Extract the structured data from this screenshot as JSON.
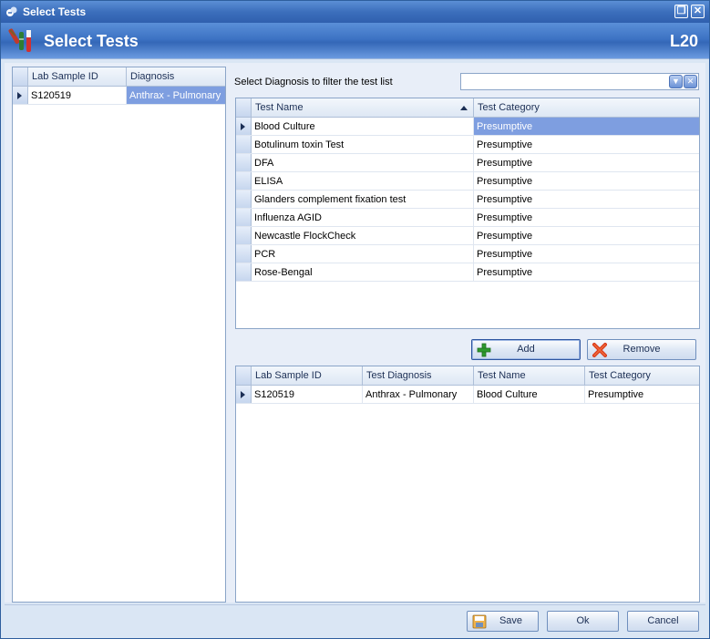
{
  "window": {
    "title": "Select Tests",
    "header_title": "Select Tests",
    "header_code": "L20",
    "restore_glyph": "❐",
    "close_glyph": "✕"
  },
  "samples_grid": {
    "columns": [
      "Lab Sample ID",
      "Diagnosis"
    ],
    "rows": [
      {
        "lab_sample_id": "S120519",
        "diagnosis": "Anthrax - Pulmonary"
      }
    ]
  },
  "filter": {
    "label": "Select Diagnosis to filter the test list",
    "value": ""
  },
  "tests_grid": {
    "columns": [
      "Test Name",
      "Test Category"
    ],
    "sort": "Test Name ascending",
    "rows": [
      {
        "test_name": "Blood Culture",
        "test_category": "Presumptive"
      },
      {
        "test_name": "Botulinum toxin Test",
        "test_category": "Presumptive"
      },
      {
        "test_name": "DFA",
        "test_category": "Presumptive"
      },
      {
        "test_name": "ELISA",
        "test_category": "Presumptive"
      },
      {
        "test_name": "Glanders complement fixation test",
        "test_category": "Presumptive"
      },
      {
        "test_name": "Influenza AGID",
        "test_category": "Presumptive"
      },
      {
        "test_name": "Newcastle FlockCheck",
        "test_category": "Presumptive"
      },
      {
        "test_name": "PCR",
        "test_category": "Presumptive"
      },
      {
        "test_name": "Rose-Bengal",
        "test_category": "Presumptive"
      }
    ]
  },
  "actions": {
    "add_label": "Add",
    "remove_label": "Remove"
  },
  "selected_grid": {
    "columns": [
      "Lab Sample ID",
      "Test Diagnosis",
      "Test Name",
      "Test Category"
    ],
    "rows": [
      {
        "lab_sample_id": "S120519",
        "test_diagnosis": "Anthrax - Pulmonary",
        "test_name": "Blood Culture",
        "test_category": "Presumptive"
      }
    ]
  },
  "footer": {
    "save_label": "Save",
    "ok_label": "Ok",
    "cancel_label": "Cancel"
  },
  "colors": {
    "accent": "#3d73c4",
    "selection": "#7e9ee0"
  }
}
